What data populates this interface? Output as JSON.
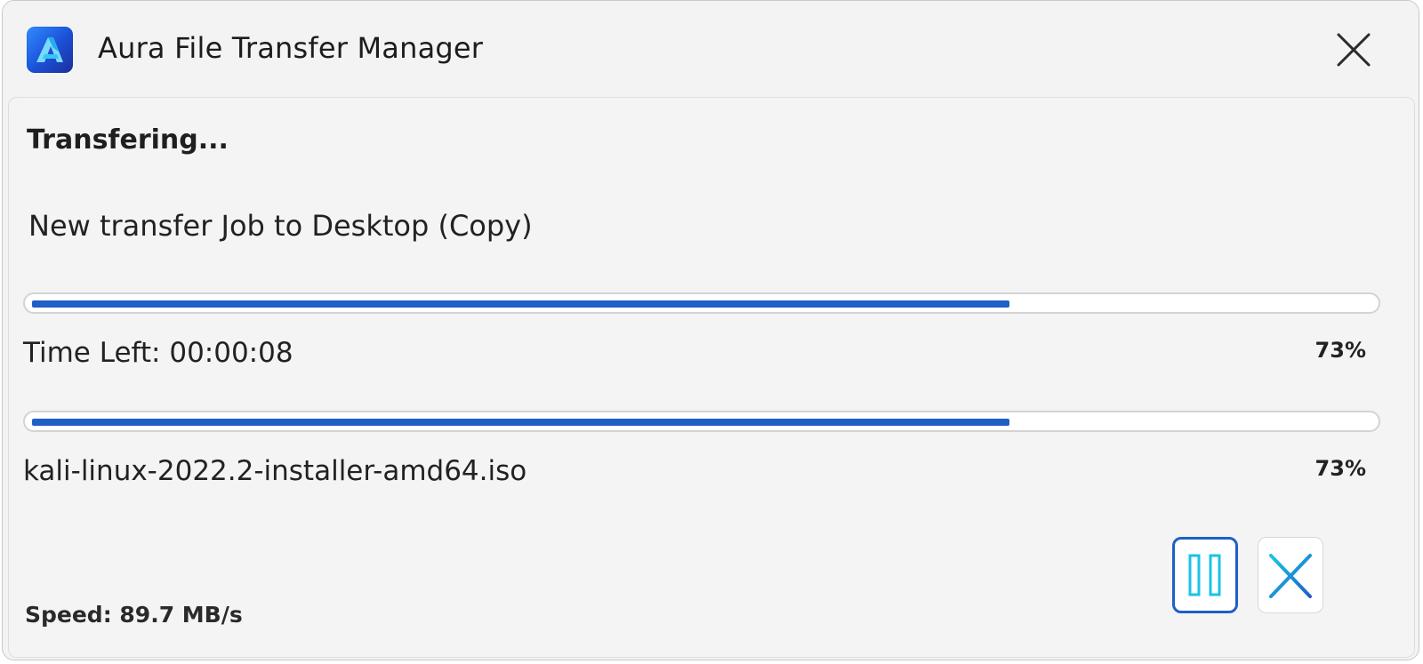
{
  "window": {
    "title": "Aura File Transfer Manager",
    "app_icon": "aura-logo-icon",
    "close_icon": "close-icon"
  },
  "transfer": {
    "status": "Transfering...",
    "job_description": "New transfer Job to Desktop (Copy)",
    "overall": {
      "progress_fraction": 0.73,
      "time_left_label": "Time Left: 00:00:08",
      "percent_label": "73%"
    },
    "file": {
      "progress_fraction": 0.73,
      "name": "kali-linux-2022.2-installer-amd64.iso",
      "percent_label": "73%"
    },
    "speed_label": "Speed: 89.7 MB/s"
  },
  "controls": {
    "pause_icon": "pause-icon",
    "cancel_icon": "cancel-icon"
  },
  "colors": {
    "accent": "#1f5fc8",
    "icon_cyan": "#19c3e6",
    "window_bg": "#f3f3f3"
  }
}
